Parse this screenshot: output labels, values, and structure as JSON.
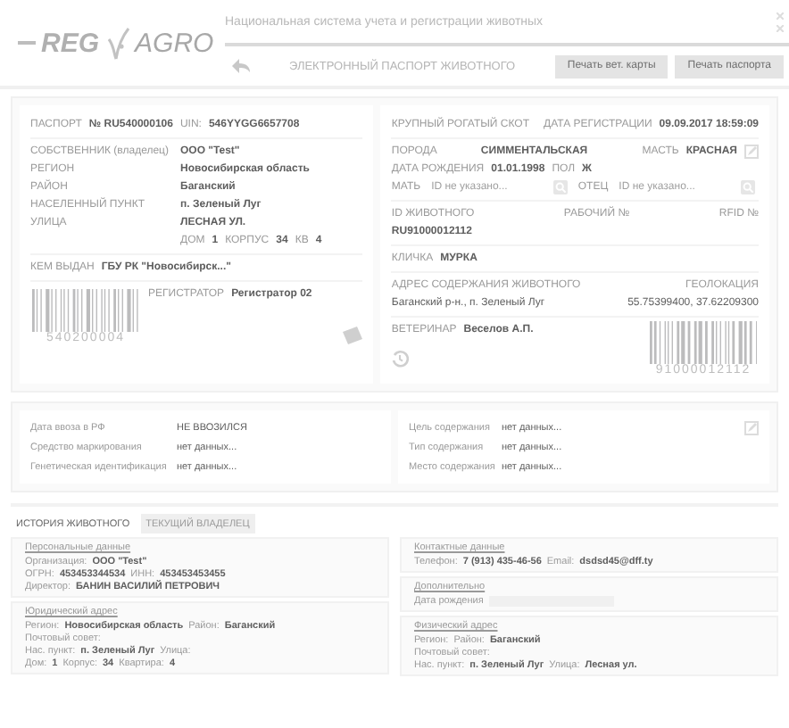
{
  "header": {
    "logo": {
      "left": "REG",
      "right": "AGRO"
    },
    "system_title": "Национальная система учета и регистрации животных",
    "page_title": "ЭЛЕКТРОННЫЙ ПАСПОРТ ЖИВОТНОГО",
    "buttons": [
      "Печать вет. карты",
      "Печать паспорта"
    ]
  },
  "passport": {
    "left": {
      "passport_label": "ПАСПОРТ",
      "passport_number": "№ RU540000106",
      "uin_label": "UIN:",
      "uin": "546YYGG6657708",
      "fields": [
        {
          "label": "СОБСТВЕННИК (владелец)",
          "value": "ООО \"Test\""
        },
        {
          "label": "РЕГИОН",
          "value": "Новосибирская область"
        },
        {
          "label": "РАЙОН",
          "value": "Баганский"
        },
        {
          "label": "НАСЕЛЕННЫЙ ПУНКТ",
          "value": "п. Зеленый Луг"
        },
        {
          "label": "УЛИЦА",
          "value": "ЛЕСНАЯ УЛ."
        }
      ],
      "house": [
        {
          "label": "ДОМ",
          "value": "1"
        },
        {
          "label": "КОРПУС",
          "value": "34"
        },
        {
          "label": "КВ",
          "value": "4"
        }
      ],
      "issued_by": {
        "label": "КЕМ ВЫДАН",
        "value": "ГБУ РК \"Новосибирск...\""
      },
      "registrar": {
        "label": "РЕГИСТРАТОР",
        "value": "Регистратор 02"
      },
      "barcode": "540200004"
    },
    "right": {
      "species": "КРУПНЫЙ РОГАТЫЙ СКОТ",
      "registration": {
        "label": "ДАТА РЕГИСТРАЦИИ",
        "value": "09.09.2017 18:59:09"
      },
      "breed": {
        "label": "ПОРОДА",
        "value": "СИММЕНТАЛЬСКАЯ"
      },
      "coat": {
        "label": "МАСТЬ",
        "value": "КРАСНАЯ"
      },
      "birth": {
        "label": "ДАТА РОЖДЕНИЯ",
        "value": "01.01.1998"
      },
      "sex": {
        "label": "ПОЛ",
        "value": "Ж"
      },
      "parents": [
        {
          "label": "МАТЬ",
          "placeholder": "ID не указано..."
        },
        {
          "label": "ОТЕЦ",
          "placeholder": "ID не указано..."
        }
      ],
      "id_headers": [
        "ID ЖИВОТНОГО",
        "РАБОЧИЙ №",
        "RFID №"
      ],
      "animal_id": "RU91000012112",
      "name": {
        "label": "КЛИЧКА",
        "value": "МУРКА"
      },
      "address_label": "АДРЕС СОДЕРЖАНИЯ ЖИВОТНОГО",
      "geo_label": "ГЕОЛОКАЦИЯ",
      "address": "Баганский р-н., п. Зеленый Луг",
      "coordinates": "55.75399400, 37.62209300",
      "vet": {
        "label": "ВЕТЕРИНАР",
        "value": "Веселов А.П."
      },
      "barcode": "91000012112"
    }
  },
  "extra": {
    "left": [
      {
        "label": "Дата ввоза в РФ",
        "value": "НЕ ВВОЗИЛСЯ"
      },
      {
        "label": "Средство маркирования",
        "value": "нет данных..."
      },
      {
        "label": "Генетическая идентификация",
        "value": "нет данных..."
      }
    ],
    "right": [
      {
        "label": "Цель содержания",
        "value": "нет данных..."
      },
      {
        "label": "Тип содержания",
        "value": "нет данных..."
      },
      {
        "label": "Место содержания",
        "value": "нет данных..."
      }
    ]
  },
  "tabs": [
    {
      "label": "ИСТОРИЯ ЖИВОТНОГО",
      "selected": true
    },
    {
      "label": "ТЕКУЩИЙ ВЛАДЕЛЕЦ",
      "selected": false
    }
  ],
  "owner": {
    "left": [
      {
        "title": "Персональные данные",
        "lines": [
          [
            {
              "label": "Организация:",
              "value": "ООО \"Test\""
            }
          ],
          [
            {
              "label": "ОГРН:",
              "value": "453453344534"
            },
            {
              "label": "ИНН:",
              "value": "453453453455"
            }
          ],
          [
            {
              "label": "Директор:",
              "value": "БАНИН ВАСИЛИЙ ПЕТРОВИЧ"
            }
          ]
        ]
      },
      {
        "title": "Юридический адрес",
        "lines": [
          [
            {
              "label": "Регион:",
              "value": "Новосибирская область"
            },
            {
              "label": "Район:",
              "value": "Баганский"
            }
          ],
          [
            {
              "label": "Почтовый совет:"
            }
          ],
          [
            {
              "label": "Нас. пункт:",
              "value": "п. Зеленый Луг"
            },
            {
              "label": "Улица:"
            }
          ],
          [
            {
              "label": "Дом:",
              "value": "1"
            },
            {
              "label": "Корпус:",
              "value": "34"
            },
            {
              "label": "Квартира:",
              "value": "4"
            }
          ]
        ]
      }
    ],
    "right": [
      {
        "title": "Контактные данные",
        "lines": [
          [
            {
              "label": "Телефон:",
              "value": "7 (913) 435-46-56"
            },
            {
              "label": "Email:",
              "value": "dsdsd45@dff.ty"
            }
          ]
        ]
      },
      {
        "title": "Дополнительно",
        "field_label": "Дата рождения"
      },
      {
        "title": "Физический адрес",
        "lines": [
          [
            {
              "label": "Регион:"
            },
            {
              "label": "Район:",
              "value": "Баганский"
            }
          ],
          [
            {
              "label": "Почтовый совет:"
            }
          ],
          [
            {
              "label": "Нас. пункт:",
              "value": "п. Зеленый Луг"
            },
            {
              "label": "Улица:",
              "value": "Лесная ул."
            }
          ]
        ]
      }
    ]
  }
}
